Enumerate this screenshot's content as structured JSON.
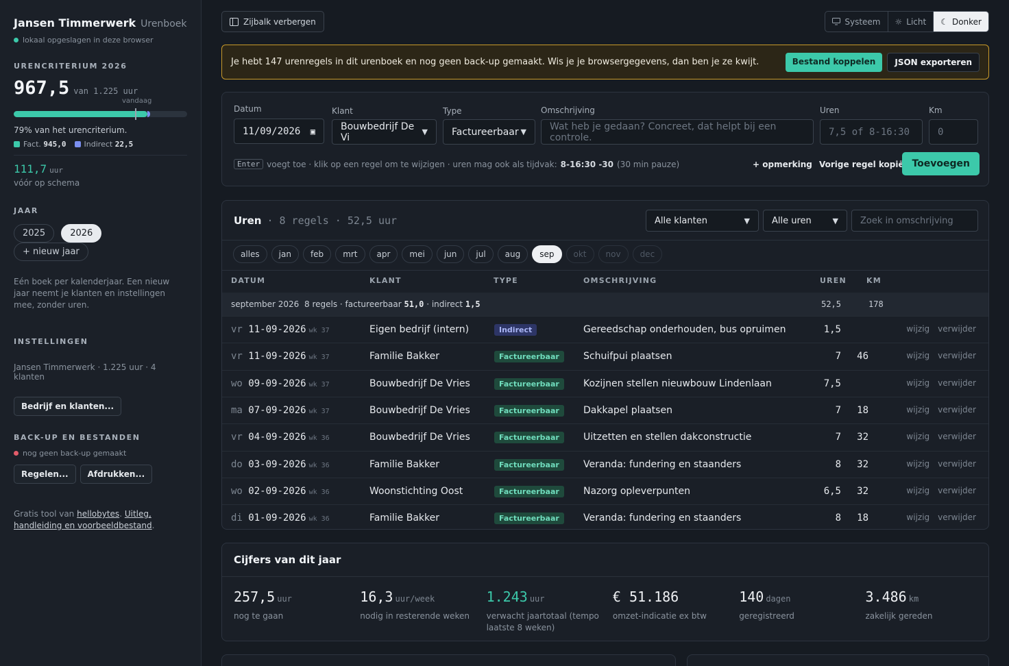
{
  "sidebar": {
    "brand": "Jansen Timmerwerk",
    "brand_sub": "Urenboek",
    "stored_note": "lokaal opgeslagen in deze browser",
    "criterium_title": "URENCRITERIUM 2026",
    "hours_done": "967,5",
    "hours_of": "van 1.225 uur",
    "today_label": "vandaag",
    "progress_fraction": 0.79,
    "indirect_fraction": 0.018,
    "today_fraction": 0.7,
    "pct_text": "79% van het urencriterium.",
    "fact_label": "Fact.",
    "fact_value": "945,0",
    "indirect_label": "Indirect",
    "indirect_value": "22,5",
    "ahead_value": "111,7",
    "ahead_unit": "uur",
    "ahead_text": "vóór op schema",
    "year_title": "JAAR",
    "years": [
      "2025",
      "2026"
    ],
    "new_year": "+ nieuw jaar",
    "year_note": "Eén boek per kalenderjaar. Een nieuw jaar neemt je klanten en instellingen mee, zonder uren.",
    "settings_title": "INSTELLINGEN",
    "settings_summary": "Jansen Timmerwerk · 1.225 uur · 4 klanten",
    "settings_button": "Bedrijf en klanten...",
    "backup_title": "BACK-UP EN BESTANDEN",
    "backup_status": "nog geen back-up gemaakt",
    "rules_button": "Regelen...",
    "print_button": "Afdrukken...",
    "footer_prefix": "Gratis tool van",
    "footer_link1": "hellobytes",
    "footer_link2": "Uitleg, handleiding en voorbeeldbestand",
    "colors": {
      "accent": "#3cc9aa",
      "indirect": "#7b8ff0",
      "danger": "#e25c6a"
    }
  },
  "topbar": {
    "toggle_sidebar": "Zijbalk verbergen",
    "theme_system": "Systeem",
    "theme_light": "Licht",
    "theme_dark": "Donker"
  },
  "banner": {
    "text": "Je hebt 147 urenregels in dit urenboek en nog geen back-up gemaakt. Wis je je browsergegevens, dan ben je ze kwijt.",
    "link_file": "Bestand koppelen",
    "export_json": "JSON exporteren"
  },
  "form": {
    "date_label": "Datum",
    "date_value": "11/09/2026",
    "client_label": "Klant",
    "client_value": "Bouwbedrijf De Vi",
    "type_label": "Type",
    "type_value": "Factureerbaar",
    "desc_label": "Omschrijving",
    "desc_placeholder": "Wat heb je gedaan? Concreet, dat helpt bij een controle.",
    "hours_label": "Uren",
    "hours_placeholder": "7,5 of 8-16:30",
    "km_label": "Km",
    "km_placeholder": "0",
    "hint_key": "Enter",
    "hint_text": "voegt toe · klik op een regel om te wijzigen · uren mag ook als tijdvak:",
    "hint_example": "8-16:30 -30",
    "hint_suffix": "(30 min pauze)",
    "note_link": "+ opmerking",
    "copy_link": "Vorige regel kopiëren",
    "add_button": "Toevoegen"
  },
  "list": {
    "title": "Uren",
    "meta": "· 8 regels · 52,5 uur",
    "filter_client": "Alle klanten",
    "filter_hours": "Alle uren",
    "search_placeholder": "Zoek in omschrijving",
    "months": [
      {
        "label": "alles",
        "state": "normal"
      },
      {
        "label": "jan",
        "state": "normal"
      },
      {
        "label": "feb",
        "state": "normal"
      },
      {
        "label": "mrt",
        "state": "normal"
      },
      {
        "label": "apr",
        "state": "normal"
      },
      {
        "label": "mei",
        "state": "normal"
      },
      {
        "label": "jun",
        "state": "normal"
      },
      {
        "label": "jul",
        "state": "normal"
      },
      {
        "label": "aug",
        "state": "normal"
      },
      {
        "label": "sep",
        "state": "active"
      },
      {
        "label": "okt",
        "state": "disabled"
      },
      {
        "label": "nov",
        "state": "disabled"
      },
      {
        "label": "dec",
        "state": "disabled"
      }
    ],
    "columns": {
      "date": "DATUM",
      "client": "KLANT",
      "type": "TYPE",
      "desc": "OMSCHRIJVING",
      "hours": "UREN",
      "km": "KM"
    },
    "group": {
      "month": "september 2026",
      "summary_prefix": "8 regels · factureerbaar",
      "billable": "51,0",
      "summary_mid": "· indirect",
      "indirect": "1,5",
      "hours": "52,5",
      "km": "178"
    },
    "edit_label": "wijzig",
    "delete_label": "verwijder",
    "rows": [
      {
        "dow": "vr",
        "date": "11-09-2026",
        "wk": "wk 37",
        "client": "Eigen bedrijf (intern)",
        "type": "Indirect",
        "desc": "Gereedschap onderhouden, bus opruimen",
        "hours": "1,5",
        "km": ""
      },
      {
        "dow": "vr",
        "date": "11-09-2026",
        "wk": "wk 37",
        "client": "Familie Bakker",
        "type": "Factureerbaar",
        "desc": "Schuifpui plaatsen",
        "hours": "7",
        "km": "46"
      },
      {
        "dow": "wo",
        "date": "09-09-2026",
        "wk": "wk 37",
        "client": "Bouwbedrijf De Vries",
        "type": "Factureerbaar",
        "desc": "Kozijnen stellen nieuwbouw Lindenlaan",
        "hours": "7,5",
        "km": ""
      },
      {
        "dow": "ma",
        "date": "07-09-2026",
        "wk": "wk 37",
        "client": "Bouwbedrijf De Vries",
        "type": "Factureerbaar",
        "desc": "Dakkapel plaatsen",
        "hours": "7",
        "km": "18"
      },
      {
        "dow": "vr",
        "date": "04-09-2026",
        "wk": "wk 36",
        "client": "Bouwbedrijf De Vries",
        "type": "Factureerbaar",
        "desc": "Uitzetten en stellen dakconstructie",
        "hours": "7",
        "km": "32"
      },
      {
        "dow": "do",
        "date": "03-09-2026",
        "wk": "wk 36",
        "client": "Familie Bakker",
        "type": "Factureerbaar",
        "desc": "Veranda: fundering en staanders",
        "hours": "8",
        "km": "32"
      },
      {
        "dow": "wo",
        "date": "02-09-2026",
        "wk": "wk 36",
        "client": "Woonstichting Oost",
        "type": "Factureerbaar",
        "desc": "Nazorg opleverpunten",
        "hours": "6,5",
        "km": "32"
      },
      {
        "dow": "di",
        "date": "01-09-2026",
        "wk": "wk 36",
        "client": "Familie Bakker",
        "type": "Factureerbaar",
        "desc": "Veranda: fundering en staanders",
        "hours": "8",
        "km": "18"
      }
    ]
  },
  "stats": {
    "title": "Cijfers van dit jaar",
    "items": [
      {
        "value": "257,5",
        "unit": "uur",
        "desc": "nog te gaan",
        "accent": false
      },
      {
        "value": "16,3",
        "unit": "uur/week",
        "desc": "nodig in resterende weken",
        "accent": false
      },
      {
        "value": "1.243",
        "unit": "uur",
        "desc": "verwacht jaartotaal (tempo laatste 8 weken)",
        "accent": true
      },
      {
        "value": "€ 51.186",
        "unit": "",
        "desc": "omzet-indicatie ex btw",
        "accent": false
      },
      {
        "value": "140",
        "unit": "dagen",
        "desc": "geregistreerd",
        "accent": false
      },
      {
        "value": "3.486",
        "unit": "km",
        "desc": "zakelijk gereden",
        "accent": false
      }
    ]
  }
}
